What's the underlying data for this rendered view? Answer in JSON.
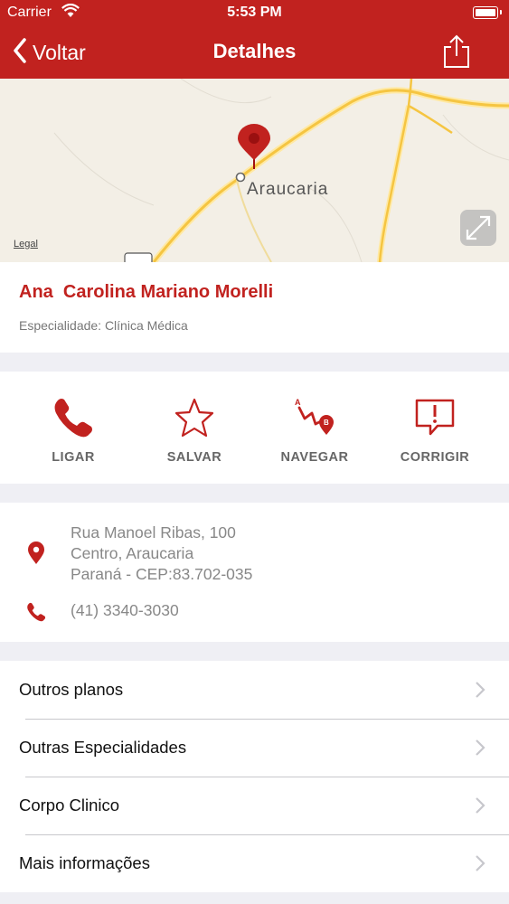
{
  "status_bar": {
    "carrier": "Carrier",
    "time": "5:53 PM"
  },
  "nav": {
    "back_label": "Voltar",
    "title": "Detalhes"
  },
  "map": {
    "city_label": "Araucaria",
    "legal_label": "Legal"
  },
  "doctor": {
    "name": "Ana  Carolina Mariano Morelli",
    "specialty": "Especialidade: Clínica Médica"
  },
  "actions": [
    {
      "label": "LIGAR",
      "icon": "phone-icon"
    },
    {
      "label": "SALVAR",
      "icon": "star-icon"
    },
    {
      "label": "NAVEGAR",
      "icon": "route-icon"
    },
    {
      "label": "CORRIGIR",
      "icon": "alert-bubble-icon"
    }
  ],
  "contact": {
    "address_line1": "Rua Manoel Ribas, 100",
    "address_line2": "Centro, Araucaria",
    "address_line3": "Paraná - CEP:83.702-035",
    "phone": "(41) 3340-3030"
  },
  "menu": [
    {
      "label": "Outros planos"
    },
    {
      "label": "Outras Especialidades"
    },
    {
      "label": "Corpo Clinico"
    },
    {
      "label": "Mais informações"
    }
  ],
  "colors": {
    "brand_red": "#c1221f",
    "background": "#efeff4"
  }
}
